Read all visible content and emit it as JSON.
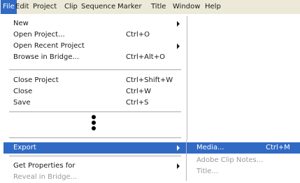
{
  "menubar": {
    "items": [
      "File",
      "Edit",
      "Project",
      "Clip",
      "Sequence",
      "Marker",
      "Title",
      "Window",
      "Help"
    ]
  },
  "file_menu": {
    "new": {
      "label": "New"
    },
    "open_project": {
      "label": "Open Project...",
      "shortcut": "Ctrl+O"
    },
    "open_recent": {
      "label": "Open Recent Project"
    },
    "browse_bridge": {
      "label": "Browse in Bridge...",
      "shortcut": "Ctrl+Alt+O"
    },
    "close_project": {
      "label": "Close Project",
      "shortcut": "Ctrl+Shift+W"
    },
    "close": {
      "label": "Close",
      "shortcut": "Ctrl+W"
    },
    "save": {
      "label": "Save",
      "shortcut": "Ctrl+S"
    },
    "export": {
      "label": "Export"
    },
    "get_properties": {
      "label": "Get Properties for"
    },
    "reveal_bridge": {
      "label": "Reveal in Bridge..."
    }
  },
  "export_submenu": {
    "media": {
      "label": "Media...",
      "shortcut": "Ctrl+M"
    },
    "clip_notes": {
      "label": "Adobe Clip Notes..."
    },
    "title": {
      "label": "Title..."
    }
  },
  "colors": {
    "highlight": "#316ac5",
    "menubar": "#ece9d8",
    "disabled": "#9a9a9a"
  }
}
